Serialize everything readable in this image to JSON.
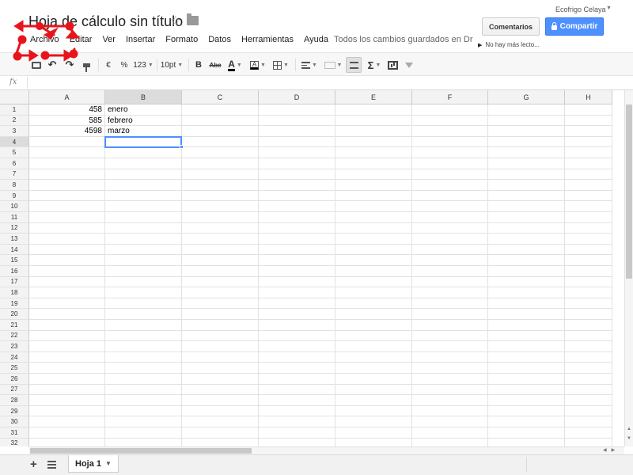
{
  "header": {
    "doc_title": "Hoja de cálculo sin título",
    "save_status": "Todos los cambios guardados en Drive",
    "user_name": "Ecofrigo Celaya",
    "comments_label": "Comentarios",
    "share_label": "Compartir",
    "viewers_label": "No hay más lecto..."
  },
  "menu": [
    "Archivo",
    "Editar",
    "Ver",
    "Insertar",
    "Formato",
    "Datos",
    "Herramientas",
    "Ayuda"
  ],
  "toolbar": {
    "currency": "€",
    "percent": "%",
    "number_format": "123",
    "font_size": "10pt",
    "bold": "B",
    "strikethrough": "Abc",
    "font_color": "A",
    "fill_color": "A",
    "sum": "Σ"
  },
  "formula_bar": {
    "fx_label": "fx",
    "value": ""
  },
  "grid": {
    "columns": [
      "A",
      "B",
      "C",
      "D",
      "E",
      "F",
      "G",
      "H"
    ],
    "selected_column": "B",
    "selected_row": 4,
    "row_count": 32,
    "cells": [
      {
        "row": 1,
        "col": "A",
        "value": "458",
        "numeric": true
      },
      {
        "row": 1,
        "col": "B",
        "value": "enero",
        "numeric": false
      },
      {
        "row": 2,
        "col": "A",
        "value": "585",
        "numeric": true
      },
      {
        "row": 2,
        "col": "B",
        "value": "febrero",
        "numeric": false
      },
      {
        "row": 3,
        "col": "A",
        "value": "4598",
        "numeric": true
      },
      {
        "row": 3,
        "col": "B",
        "value": "marzo",
        "numeric": false
      }
    ]
  },
  "sheets": [
    {
      "name": "Hoja 1",
      "active": true
    }
  ],
  "colors": {
    "accent": "#4d90fe",
    "annotation": "#e8141c",
    "header_bg": "#f3f3f3",
    "selected_header_bg": "#dcdcdc"
  }
}
